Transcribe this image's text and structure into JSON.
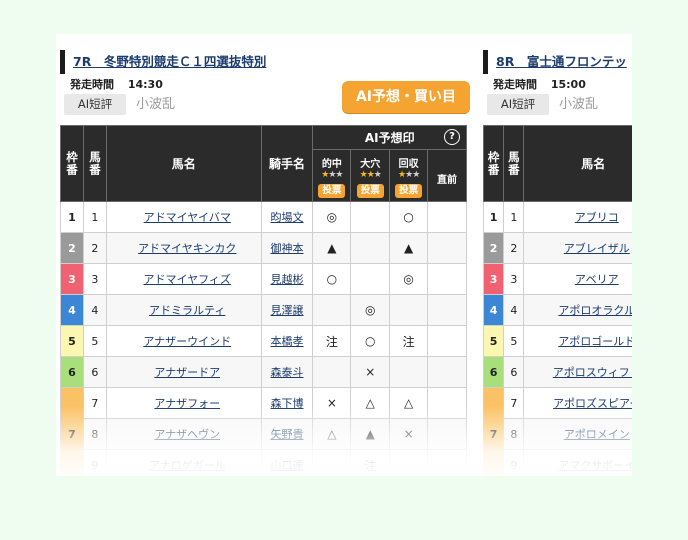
{
  "left": {
    "race_title": "7R　冬野特別競走Ｃ１四選抜特別",
    "start_label": "発走時間",
    "start_time": "14:30",
    "ai_tag": "AI短評",
    "ai_tag_value": "小波乱",
    "buy_button": "AI予想・買い目",
    "headers": {
      "waku": "枠番",
      "uma": "馬番",
      "horse": "馬名",
      "jockey": "騎手名",
      "ai": "AI予想印",
      "help": "?",
      "tekichu": "的中",
      "ana": "大穴",
      "kaishu": "回収",
      "vote": "投票",
      "chokuzen": "直前"
    },
    "rows": [
      {
        "waku": "1",
        "uma": "1",
        "horse": "アドマイヤイバマ",
        "jockey": "昀場文",
        "m1": "◎",
        "m2": "",
        "m3": "○"
      },
      {
        "waku": "2",
        "uma": "2",
        "horse": "アドマイヤキンカク",
        "jockey": "御神本",
        "m1": "▲",
        "m2": "",
        "m3": "▲"
      },
      {
        "waku": "3",
        "uma": "3",
        "horse": "アドマイヤフィズ",
        "jockey": "見越彬",
        "m1": "○",
        "m2": "",
        "m3": "◎"
      },
      {
        "waku": "4",
        "uma": "4",
        "horse": "アドミラルティ",
        "jockey": "見澤譲",
        "m1": "",
        "m2": "◎",
        "m3": ""
      },
      {
        "waku": "5",
        "uma": "5",
        "horse": "アナザーウインド",
        "jockey": "本橋孝",
        "m1": "注",
        "m2": "○",
        "m3": "注"
      },
      {
        "waku": "6",
        "uma": "6",
        "horse": "アナザードア",
        "jockey": "森泰斗",
        "m1": "",
        "m2": "×",
        "m3": ""
      },
      {
        "waku": "7",
        "uma": "7",
        "horse": "アナザフォー",
        "jockey": "森下博",
        "m1": "×",
        "m2": "△",
        "m3": "△"
      },
      {
        "waku": "",
        "uma": "8",
        "horse": "アナザヘヴン",
        "jockey": "矢野貴",
        "m1": "△",
        "m2": "▲",
        "m3": "×"
      },
      {
        "waku": "",
        "uma": "9",
        "horse": "アナロゲガール",
        "jockey": "山口達",
        "m1": "",
        "m2": "注",
        "m3": ""
      }
    ]
  },
  "right": {
    "race_title": "8R　富士通フロンテッ",
    "start_label": "発走時間",
    "start_time": "15:00",
    "ai_tag": "AI短評",
    "ai_tag_value": "小波乱",
    "headers": {
      "waku": "枠番",
      "uma": "馬番",
      "horse": "馬名"
    },
    "rows": [
      {
        "waku": "1",
        "uma": "1",
        "horse": "アブリコ"
      },
      {
        "waku": "2",
        "uma": "2",
        "horse": "アブレイザル"
      },
      {
        "waku": "3",
        "uma": "3",
        "horse": "アベリア"
      },
      {
        "waku": "4",
        "uma": "4",
        "horse": "アポロオラクル"
      },
      {
        "waku": "5",
        "uma": "5",
        "horse": "アポロゴールド"
      },
      {
        "waku": "6",
        "uma": "6",
        "horse": "アポロスウィフト"
      },
      {
        "waku": "7",
        "uma": "7",
        "horse": "アポロズスピアー"
      },
      {
        "waku": "",
        "uma": "8",
        "horse": "アポロメイン"
      },
      {
        "waku": "",
        "uma": "9",
        "horse": "アマクサボーイ"
      }
    ]
  },
  "waku_colors": {
    "1": "#ffffff",
    "2": "#9a9a9a",
    "3": "#f06272",
    "4": "#3c86d6",
    "5": "#fbf6b0",
    "6": "#a9df7b",
    "7": "#fbc265"
  },
  "waku_text_colors": {
    "1": "#222222",
    "2": "#ffffff",
    "3": "#ffffff",
    "4": "#ffffff",
    "5": "#222222",
    "6": "#222222",
    "7": "#222222"
  }
}
